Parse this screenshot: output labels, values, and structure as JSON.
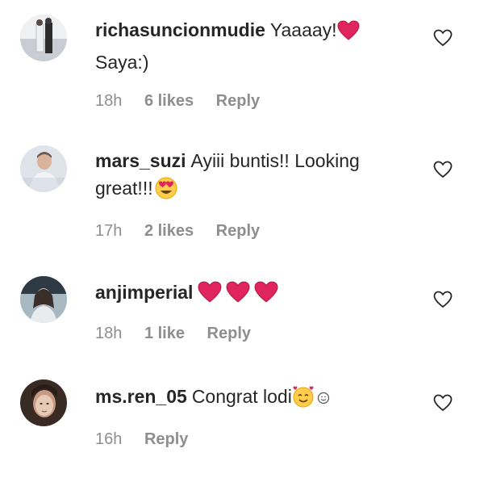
{
  "comments": [
    {
      "username": "richasuncionmudie",
      "text": "Yaaaay!",
      "text_after": "Saya:)",
      "emojis": [
        "red-heart"
      ],
      "time": "18h",
      "likes": "6 likes",
      "reply_label": "Reply",
      "avatar_colors": [
        "#c9cdd3",
        "#eef0f2",
        "#2c2c2c"
      ]
    },
    {
      "username": "mars_suzi",
      "text": "Ayiii buntis!! Looking great!!!",
      "emojis": [
        "heart-eyes"
      ],
      "time": "17h",
      "likes": "2 likes",
      "reply_label": "Reply",
      "avatar_colors": [
        "#dfe3ea",
        "#b8c2cf",
        "#6b5a52"
      ]
    },
    {
      "username": "anjimperial",
      "text": "",
      "emojis": [
        "red-heart",
        "red-heart",
        "red-heart"
      ],
      "time": "18h",
      "likes": "1 like",
      "reply_label": "Reply",
      "avatar_colors": [
        "#2e3a44",
        "#a8b8c2",
        "#d9c4b6"
      ]
    },
    {
      "username": "ms.ren_05",
      "text": "Congrat lodi",
      "emojis": [
        "smiling-hearts",
        "small-smile"
      ],
      "time": "16h",
      "likes": "",
      "reply_label": "Reply",
      "avatar_colors": [
        "#3a2a24",
        "#c79a84",
        "#e7c9b8"
      ]
    }
  ],
  "colors": {
    "text": "#262626",
    "meta": "#8e8e8e",
    "heart_red": "#e0245e",
    "emoji_yellow": "#ffcc4d"
  }
}
